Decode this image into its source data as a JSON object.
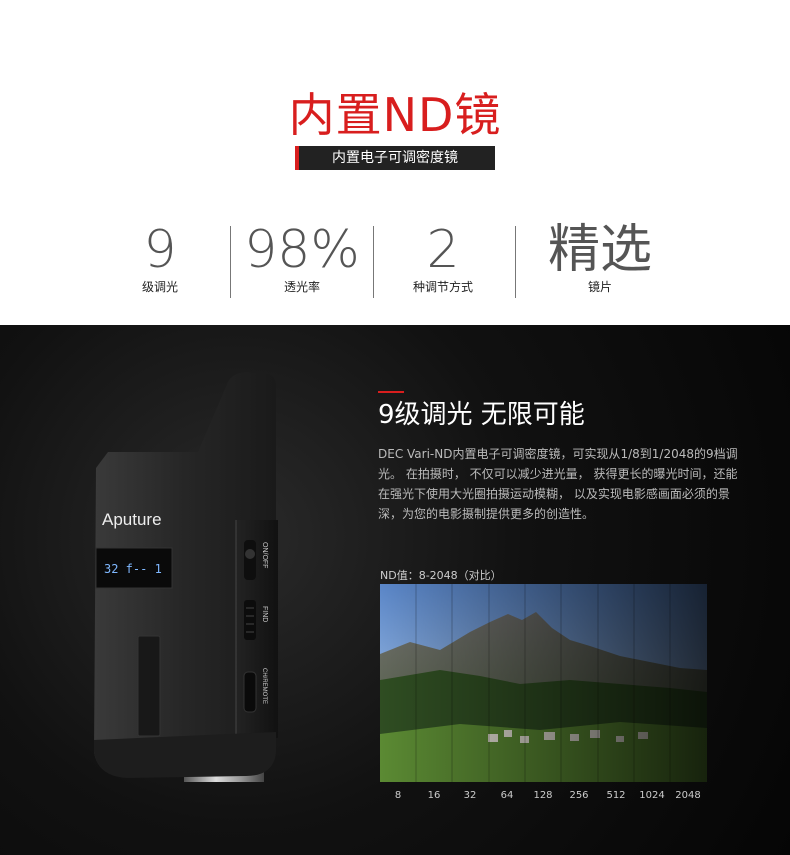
{
  "header": {
    "title": "内置ND镜",
    "subtitle": "内置电子可调密度镜",
    "accent_color": "#d81e1e"
  },
  "stats": [
    {
      "big": "9",
      "small": "级调光"
    },
    {
      "big": "98%",
      "small": "透光率"
    },
    {
      "big": "2",
      "small": "种调节方式"
    },
    {
      "big": "精选",
      "small": "镜片"
    }
  ],
  "device": {
    "brand": "Aputure",
    "display_text": "32 f-- 1",
    "switch_label": "ON/OFF",
    "find_label": "FIND",
    "port_label": "CH/REMOTE"
  },
  "feature": {
    "heading": "9级调光 无限可能",
    "paragraph": "DEC Vari-ND内置电子可调密度镜，可实现从1/8到1/2048的9档调光。 在拍摄时， 不仅可以减少进光量， 获得更长的曝光时间，还能在强光下使用大光圈拍摄运动模糊， 以及实现电影感画面必须的景深，为您的电影摄制提供更多的创造性。",
    "comparison_title": "ND值：8-2048（对比）",
    "nd_values": [
      "8",
      "16",
      "32",
      "64",
      "128",
      "256",
      "512",
      "1024",
      "2048"
    ]
  }
}
